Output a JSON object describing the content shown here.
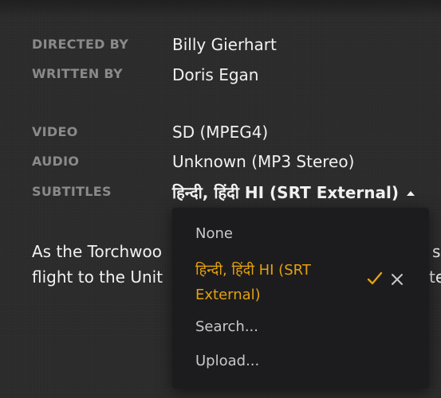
{
  "metadata": [
    {
      "label": "DIRECTED BY",
      "value": "Billy Gierhart"
    },
    {
      "label": "WRITTEN BY",
      "value": "Doris Egan"
    },
    {
      "label": "VIDEO",
      "value": "SD (MPEG4)"
    },
    {
      "label": "AUDIO",
      "value": "Unknown (MP3 Stereo)"
    }
  ],
  "subtitles": {
    "label": "SUBTITLES",
    "selected": "हिन्दी, हिंदी HI (SRT External)"
  },
  "summary": {
    "line1": "As the Torchwoo",
    "line1_end": "s",
    "line2": "flight to the Unit",
    "line2_end": "te"
  },
  "dropdown": {
    "items": [
      {
        "label": "None"
      },
      {
        "label": "हिन्दी, हिंदी HI (SRT External)",
        "selected": true
      },
      {
        "label": "Search..."
      },
      {
        "label": "Upload..."
      }
    ],
    "icons": {
      "selected": "check-icon",
      "remove": "close-icon"
    },
    "accent_color": "#e5a00d"
  }
}
